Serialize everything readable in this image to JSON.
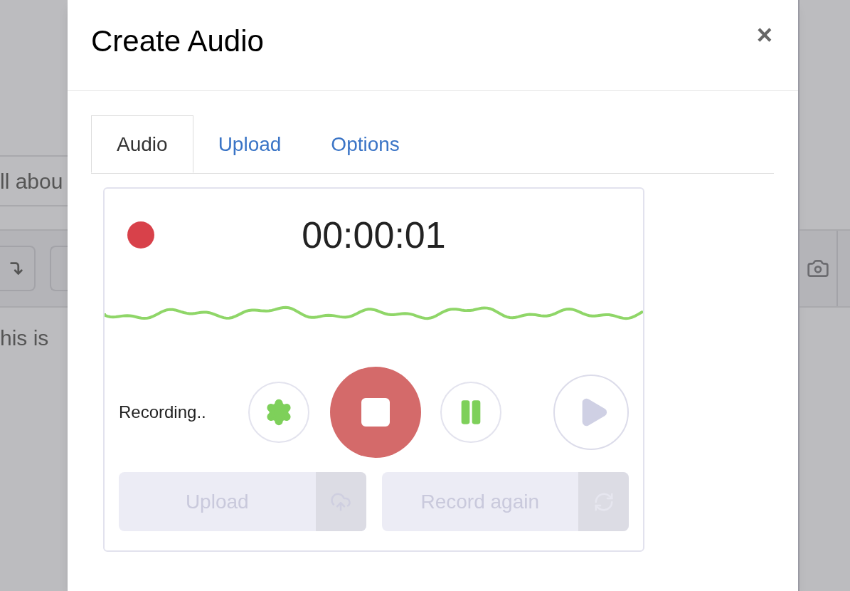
{
  "background": {
    "field_value": "ll abou",
    "body_text": "his is"
  },
  "dialog": {
    "title": "Create Audio",
    "close": "×"
  },
  "tabs": [
    {
      "label": "Audio",
      "selected": true
    },
    {
      "label": "Upload",
      "selected": false
    },
    {
      "label": "Options",
      "selected": false
    }
  ],
  "recorder": {
    "recording": true,
    "time": "00:00:01",
    "status": "Recording..",
    "paused": false
  },
  "actions": [
    {
      "label": "Upload",
      "kind": "upload",
      "disabled": true
    },
    {
      "label": "Record again",
      "kind": "reset",
      "disabled": true
    }
  ]
}
